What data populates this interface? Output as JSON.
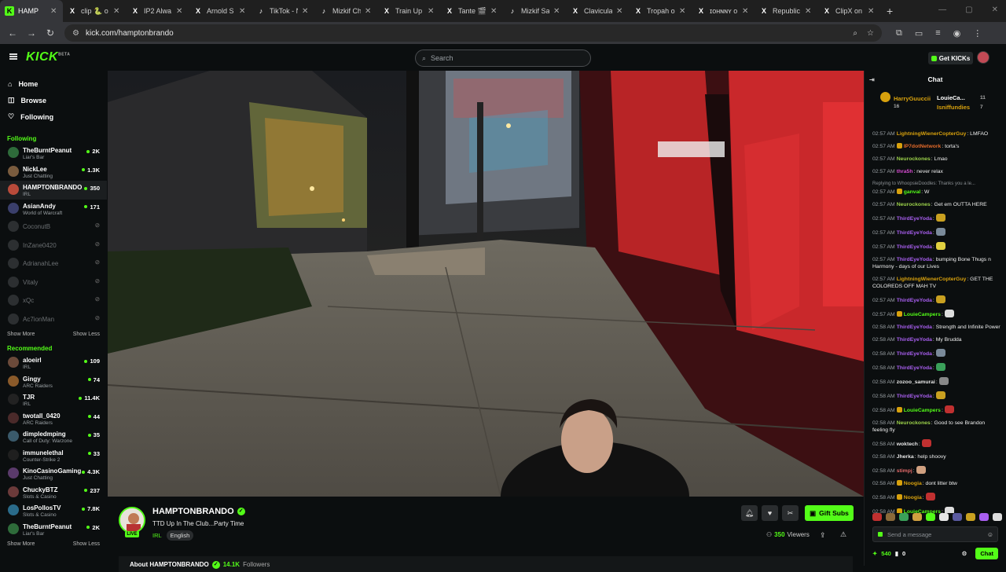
{
  "browser": {
    "tabs": [
      {
        "icon": "kick-icon",
        "title": "HAMP",
        "active": true
      },
      {
        "icon": "x-icon",
        "title": "clip 🐍 o"
      },
      {
        "icon": "x-icon",
        "title": "IP2 Alwa"
      },
      {
        "icon": "x-icon",
        "title": "Arnold S"
      },
      {
        "icon": "tiktok-icon",
        "title": "TikTok - N"
      },
      {
        "icon": "tiktok-icon",
        "title": "Mizkif Ch"
      },
      {
        "icon": "x-icon",
        "title": "Train Up"
      },
      {
        "icon": "x-icon",
        "title": "Tante 🎬"
      },
      {
        "icon": "tiktok-icon",
        "title": "Mizkif Sa"
      },
      {
        "icon": "x-icon",
        "title": "Clavicula"
      },
      {
        "icon": "x-icon",
        "title": "Tropah o"
      },
      {
        "icon": "x-icon",
        "title": "ɪᴏʜɴɴʏ o"
      },
      {
        "icon": "x-icon",
        "title": "Republic"
      },
      {
        "icon": "x-icon",
        "title": "ClipX on"
      }
    ],
    "url": "kick.com/hamptonbrando"
  },
  "header": {
    "logo": "KICK",
    "logo_sup": "BETA",
    "search_placeholder": "Search",
    "get_kicks": "Get KICKs"
  },
  "sidebar": {
    "nav": [
      {
        "icon": "home-icon",
        "label": "Home"
      },
      {
        "icon": "compass-icon",
        "label": "Browse"
      },
      {
        "icon": "heart-icon",
        "label": "Following"
      }
    ],
    "following_title": "Following",
    "following": [
      {
        "name": "TheBurntPeanut",
        "category": "Liar's Bar",
        "viewers": "2K",
        "live": true,
        "color": "#2e6b3a"
      },
      {
        "name": "NickLee",
        "category": "Just Chatting",
        "viewers": "1.3K",
        "live": true,
        "color": "#7a5c3e"
      },
      {
        "name": "HAMPTONBRANDO",
        "category": "IRL",
        "viewers": "350",
        "live": true,
        "color": "#b84a3a"
      },
      {
        "name": "AsianAndy",
        "category": "World of Warcraft",
        "viewers": "171",
        "live": true,
        "color": "#3a3f6b"
      },
      {
        "name": "CoconutB",
        "category": "",
        "viewers": "",
        "live": false,
        "color": "#2c2f31"
      },
      {
        "name": "InZane0420",
        "category": "",
        "viewers": "",
        "live": false,
        "color": "#2c2f31"
      },
      {
        "name": "AdrianahLee",
        "category": "",
        "viewers": "",
        "live": false,
        "color": "#2c2f31"
      },
      {
        "name": "Vitaly",
        "category": "",
        "viewers": "",
        "live": false,
        "color": "#2c2f31"
      },
      {
        "name": "xQc",
        "category": "",
        "viewers": "",
        "live": false,
        "color": "#2c2f31"
      },
      {
        "name": "Ac7ionMan",
        "category": "",
        "viewers": "",
        "live": false,
        "color": "#2c2f31"
      }
    ],
    "show_more": "Show More",
    "show_less": "Show Less",
    "recommended_title": "Recommended",
    "recommended": [
      {
        "name": "aloeirl",
        "category": "IRL",
        "viewers": "109",
        "color": "#6b4a3a"
      },
      {
        "name": "Gingy",
        "category": "ARC Raiders",
        "viewers": "74",
        "color": "#8a5a2a"
      },
      {
        "name": "TJR",
        "category": "IRL",
        "viewers": "11.4K",
        "color": "#222"
      },
      {
        "name": "twotall_0420",
        "category": "ARC Raiders",
        "viewers": "44",
        "color": "#4a2a2a"
      },
      {
        "name": "dimpledmping",
        "category": "Call of Duty: Warzone",
        "viewers": "35",
        "color": "#3a5a6b"
      },
      {
        "name": "immunelethal",
        "category": "Counter-Strike 2",
        "viewers": "33",
        "color": "#1f1f1f"
      },
      {
        "name": "KinoCasinoGaming",
        "category": "Just Chatting",
        "viewers": "4.3K",
        "color": "#5a3a6b"
      },
      {
        "name": "ChuckyBTZ",
        "category": "Slots & Casino",
        "viewers": "237",
        "color": "#6b3a3a"
      },
      {
        "name": "LosPollosTV",
        "category": "Slots & Casino",
        "viewers": "7.8K",
        "color": "#2a6b8a"
      },
      {
        "name": "TheBurntPeanut",
        "category": "Liar's Bar",
        "viewers": "2K",
        "color": "#2e6b3a"
      }
    ]
  },
  "stream": {
    "channel": "HAMPTONBRANDO",
    "title": "TTD Up In The Club...Party Time",
    "category": "IRL",
    "tag": "English",
    "live_badge": "LIVE",
    "viewers": "350",
    "viewers_label": "Viewers",
    "gift_subs": "Gift Subs",
    "about_label": "About HAMPTONBRANDO",
    "followers": "14.1K",
    "followers_label": "Followers"
  },
  "chat": {
    "title": "Chat",
    "pinned": {
      "top_user": "HarryGuuccii",
      "top_count": "16",
      "second_user": "LouieCa...",
      "second_count": "11",
      "third_user": "Isniffundies",
      "third_count": "7"
    },
    "messages": [
      {
        "time": "02:57 AM",
        "user": "LightningWienerCopterGuy",
        "color": "#d8a10d",
        "text": ": LMFAO"
      },
      {
        "time": "02:57 AM",
        "user": "IP7dotNetwork",
        "color": "#e36a2a",
        "text": ": torta's",
        "badge": "#d8a10d"
      },
      {
        "time": "02:57 AM",
        "user": "Neurockones",
        "color": "#9bd14a",
        "text": ": Lmao"
      },
      {
        "time": "02:57 AM",
        "user": "thra5h",
        "color": "#d64bd1",
        "text": ": never relax"
      },
      {
        "reply": "Replying to WhoopsieDoodles: Thanks you a le...",
        "time": "02:57 AM",
        "user": "ganval",
        "color": "#53fc18",
        "text": ": W",
        "badge": "#d8a10d"
      },
      {
        "time": "02:57 AM",
        "user": "Neurockones",
        "color": "#9bd14a",
        "text": ": Get em OUTTA HERE"
      },
      {
        "time": "02:57 AM",
        "user": "ThirdEyeYoda",
        "color": "#a95ff0",
        "text": ":",
        "emote": "#c9a020"
      },
      {
        "time": "02:57 AM",
        "user": "ThirdEyeYoda",
        "color": "#a95ff0",
        "text": ":",
        "emote": "#7a8a9a"
      },
      {
        "time": "02:57 AM",
        "user": "ThirdEyeYoda",
        "color": "#a95ff0",
        "text": ":",
        "emote": "#e0d040"
      },
      {
        "time": "02:57 AM",
        "user": "ThirdEyeYoda",
        "color": "#a95ff0",
        "text": ": bumping Bone Thugs n Harmony - days of our Lives"
      },
      {
        "time": "02:57 AM",
        "user": "LightningWienerCopterGuy",
        "color": "#d8a10d",
        "text": ": GET THE COLOREDS OFF MAH TV"
      },
      {
        "time": "02:57 AM",
        "user": "ThirdEyeYoda",
        "color": "#a95ff0",
        "text": ":",
        "emote": "#c9a020"
      },
      {
        "time": "02:57 AM",
        "user": "LouieCampers",
        "color": "#53fc18",
        "text": ":",
        "badge": "#d8a10d",
        "emote": "#ddd"
      },
      {
        "time": "02:58 AM",
        "user": "ThirdEyeYoda",
        "color": "#a95ff0",
        "text": ": Strength and Infinite Power"
      },
      {
        "time": "02:58 AM",
        "user": "ThirdEyeYoda",
        "color": "#a95ff0",
        "text": ": My Brudda"
      },
      {
        "time": "02:58 AM",
        "user": "ThirdEyeYoda",
        "color": "#a95ff0",
        "text": ":",
        "emote": "#7a8a9a"
      },
      {
        "time": "02:58 AM",
        "user": "ThirdEyeYoda",
        "color": "#a95ff0",
        "text": ":",
        "emote": "#3aa05a"
      },
      {
        "time": "02:58 AM",
        "user": "zozoo_samurai",
        "color": "#e6e6e6",
        "text": ":",
        "emote": "#888"
      },
      {
        "time": "02:58 AM",
        "user": "ThirdEyeYoda",
        "color": "#a95ff0",
        "text": ":",
        "emote": "#c9a020"
      },
      {
        "time": "02:58 AM",
        "user": "LouieCampers",
        "color": "#53fc18",
        "text": ":",
        "badge": "#d8a10d",
        "emote": "#c03030"
      },
      {
        "time": "02:58 AM",
        "user": "Neurockones",
        "color": "#9bd14a",
        "text": ": Good to see Brandon feeling fly"
      },
      {
        "time": "02:58 AM",
        "user": "woktech",
        "color": "#e6e6e6",
        "text": ":",
        "emote": "#c03030"
      },
      {
        "time": "02:58 AM",
        "user": "Jherka",
        "color": "#e6e6e6",
        "text": ": help shoovy"
      },
      {
        "time": "02:58 AM",
        "user": "stimpj",
        "color": "#e36a6a",
        "text": ":",
        "emote": "#d0a080"
      },
      {
        "time": "02:58 AM",
        "user": "Noogia",
        "color": "#d8a10d",
        "text": ": dont litter btw",
        "badge": "#d8a10d"
      },
      {
        "time": "02:58 AM",
        "user": "Noogia",
        "color": "#d8a10d",
        "text": ":",
        "badge": "#d8a10d",
        "emote": "#c03030"
      },
      {
        "time": "02:58 AM",
        "user": "LouieCampers",
        "color": "#53fc18",
        "text": ":",
        "badge": "#d8a10d",
        "emote": "#ddd"
      }
    ],
    "emote_bar": [
      "#c03030",
      "#8a6a3a",
      "#3aa05a",
      "#d0a040",
      "#53fc18",
      "#e6e6e6",
      "#5a5aa0",
      "#c9a020",
      "#a95ff0",
      "#ddd"
    ],
    "send_placeholder": "Send a message",
    "points": "540",
    "badges_count": "0",
    "chat_button": "Chat"
  }
}
